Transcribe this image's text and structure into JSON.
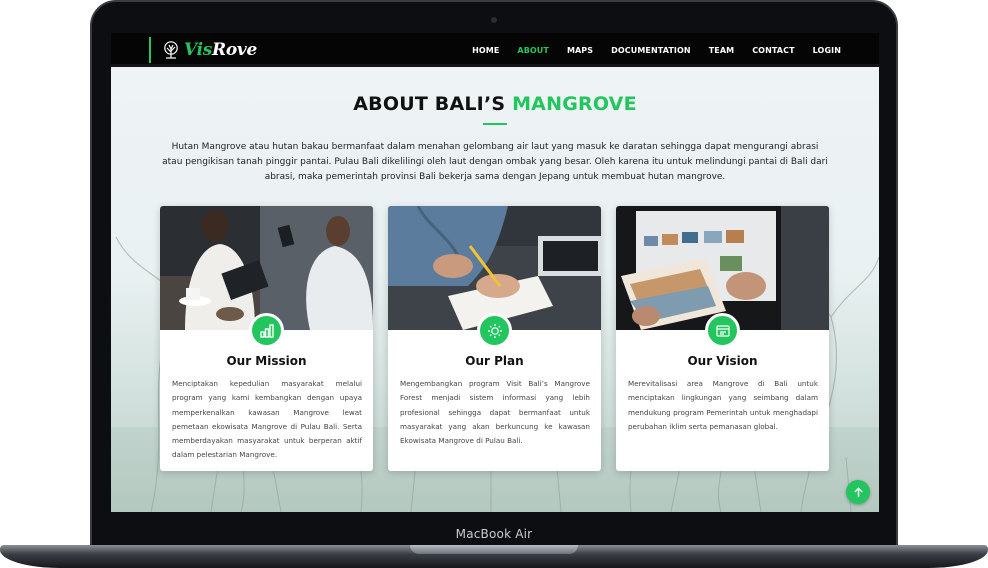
{
  "device": {
    "label": "MacBook Air"
  },
  "navbar": {
    "brand_prefix": "Vis",
    "brand_suffix": "Rove",
    "links": [
      {
        "label": "HOME",
        "active": false
      },
      {
        "label": "ABOUT",
        "active": true
      },
      {
        "label": "MAPS",
        "active": false
      },
      {
        "label": "DOCUMENTATION",
        "active": false
      },
      {
        "label": "TEAM",
        "active": false
      },
      {
        "label": "CONTACT",
        "active": false
      },
      {
        "label": "LOGIN",
        "active": false
      }
    ]
  },
  "about": {
    "title_prefix": "ABOUT BALI’S ",
    "title_highlight": "MANGROVE",
    "description": "Hutan Mangrove atau hutan bakau bermanfaat dalam menahan gelombang air laut yang masuk ke daratan sehingga dapat mengurangi abrasi atau pengikisan tanah pinggir pantai. Pulau Bali dikelilingi oleh laut dengan ombak yang besar. Oleh karena itu untuk melindungi pantai di Bali dari abrasi, maka pemerintah provinsi Bali bekerja sama dengan Jepang untuk membuat hutan mangrove.",
    "cards": [
      {
        "title": "Our Mission",
        "icon": "bar-chart-icon",
        "text": "Menciptakan kepedulian masyarakat melalui program yang kami kembangkan dengan upaya memperkenalkan kawasan Mangrove lewat pemetaan ekowisata Mangrove di Pulau Bali. Serta memberdayakan masyarakat untuk berperan aktif dalam pelestarian Mangrove."
      },
      {
        "title": "Our Plan",
        "icon": "sun-icon",
        "text": "Mengembangkan program Visit Bali’s Mangrove Forest menjadi sistem informasi yang lebih profesional sehingga dapat bermanfaat untuk masyarakat yang akan berkuncung ke kawasan Ekowisata Mangrove di Pulau Bali."
      },
      {
        "title": "Our Vision",
        "icon": "image-gallery-icon",
        "text": "Merevitalisasi area Mangrove di Bali untuk menciptakan lingkungan yang seimbang dalam mendukung program Pemerintah untuk menghadapi perubahan iklim serta pemanasan global."
      }
    ]
  },
  "colors": {
    "accent": "#22c55e",
    "navbar": "#050505",
    "text": "#111111"
  }
}
